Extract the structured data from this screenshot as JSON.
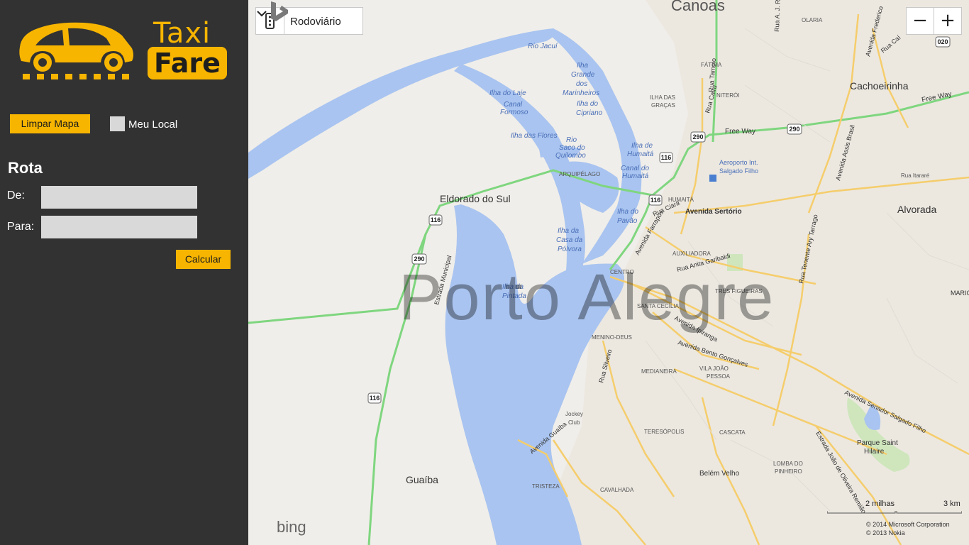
{
  "app": {
    "logo_taxi": "Taxi",
    "logo_fare": "Fare"
  },
  "toolbar": {
    "clear_map_label": "Limpar Mapa",
    "my_location_label": "Meu Local"
  },
  "route": {
    "title": "Rota",
    "from_label": "De:",
    "from_value": "",
    "to_label": "Para:",
    "to_value": "",
    "calculate_label": "Calcular"
  },
  "map": {
    "style_label": "Rodoviário",
    "zoom_out": "−",
    "zoom_in": "+",
    "brand": "bing",
    "city_label": "Porto Alegre",
    "scale_miles": "2 milhas",
    "scale_km": "3 km",
    "copyright_1": "© 2014 Microsoft Corporation",
    "copyright_2": "© 2013 Nokia",
    "colors": {
      "water": "#a9c4f0",
      "land": "#f0eeea",
      "highway": "#7fd67f",
      "arterial": "#f5cd6c",
      "park": "#c8e6b0"
    },
    "places": [
      "Canoas",
      "Cachoeirinha",
      "Alvorada",
      "Eldorado do Sul",
      "Guaíba",
      "Rio Jacuí",
      "Ilha Grande dos Marinheiros",
      "Ilha do Laje",
      "Canal Formoso",
      "Ilha do Cipriano",
      "Ilha das Flores",
      "Rio Saco do Quilombo",
      "Ilha de Humaitá",
      "Canal do Humaitá",
      "Ilha do Pavão",
      "Ilha da Casa da Pólvora",
      "Ilha da Pintada",
      "Arquipélago",
      "Fátima",
      "Niterói",
      "Ilha das Graças",
      "Olaria",
      "Aeroporto Int. Salgado Filho",
      "Humaitá",
      "Avenida Sertório",
      "Rua Itararé",
      "Auxiliadora",
      "Centro",
      "Três Figueiras",
      "Mario Quintana",
      "Santa Cecília",
      "Menino-Deus",
      "Medianeira",
      "Vila João Pessoa",
      "Jockey Club",
      "Teresópolis",
      "Cascata",
      "Parque Saint Hilaire",
      "Belém Velho",
      "Lomba do Pinheiro",
      "Tristeza",
      "Cavalhada",
      "Free Way",
      "Avenida Farrapos",
      "Avenida Ipiranga",
      "Avenida Bento Gonçalves",
      "Avenida Senador Salgado Filho",
      "Estrada Municipal",
      "Rua Silveiro",
      "Avenida Guaíba",
      "Rua Anita Garibaldi",
      "Estrada João de Oliveira Remião",
      "Rua Tenente Ary Tarrago",
      "Avenida Assis Brasil",
      "Avenida Frederico",
      "Rua Tamoio",
      "Rua Caí",
      "Rua Cairu",
      "Rua Ciará",
      "Rua A. J. Renner"
    ],
    "shields": [
      "290",
      "116",
      "020"
    ]
  }
}
